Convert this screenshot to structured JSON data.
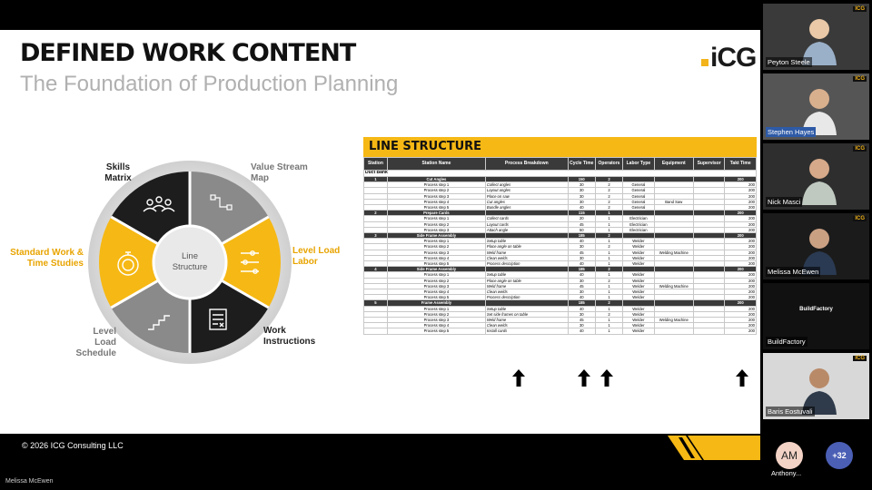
{
  "slide": {
    "title": "DEFINED WORK CONTENT",
    "subtitle": "The Foundation of Production Planning",
    "logo": "iCG",
    "footer": "© 2026 ICG Consulting LLC",
    "colors": {
      "accent": "#f6b814",
      "dark": "#1d1d1d",
      "grey": "#8a8a8a"
    }
  },
  "wheel": {
    "center": "Line Structure",
    "labels": {
      "skills": "Skills Matrix",
      "value": "Value Stream Map",
      "level_load_labor": "Level Load Labor",
      "work_instructions": "Work Instructions",
      "level_load_schedule": "Level Load Schedule",
      "standard_work": "Standard Work & Time Studies"
    }
  },
  "line_structure": {
    "title": "LINE STRUCTURE",
    "headers": [
      "Station",
      "Station Name",
      "Process Breakdown",
      "Cycle Time",
      "Operators",
      "Labor Type",
      "Equipment",
      "Supervisor",
      "Takt Time"
    ],
    "group": "Duct Bank",
    "stations": [
      {
        "num": "1",
        "name": "Cut Angles",
        "cycle": "150",
        "ops": "2",
        "takt": "200",
        "steps": [
          [
            "Process step 1",
            "Collect angles",
            "30",
            "2",
            "General",
            "",
            "200"
          ],
          [
            "Process step 2",
            "Layout angles",
            "30",
            "2",
            "General",
            "",
            "200"
          ],
          [
            "Process step 3",
            "Place on saw",
            "30",
            "2",
            "General",
            "",
            "200"
          ],
          [
            "Process step 4",
            "Cut angles",
            "30",
            "2",
            "General",
            "Band Saw",
            "200"
          ],
          [
            "Process step 5",
            "Bundle angles",
            "40",
            "2",
            "General",
            "",
            "200"
          ]
        ]
      },
      {
        "num": "2",
        "name": "Prepare Cards",
        "cycle": "115",
        "ops": "1",
        "takt": "200",
        "steps": [
          [
            "Process step 1",
            "Collect cards",
            "20",
            "1",
            "Electrician",
            "",
            "200"
          ],
          [
            "Process step 2",
            "Layout cards",
            "45",
            "1",
            "Electrician",
            "",
            "200"
          ],
          [
            "Process step 3",
            "Attach angle",
            "50",
            "1",
            "Electrician",
            "",
            "200"
          ]
        ]
      },
      {
        "num": "3",
        "name": "Side Frame Assembly",
        "cycle": "185",
        "ops": "2",
        "takt": "200",
        "steps": [
          [
            "Process step 1",
            "Setup table",
            "40",
            "1",
            "Welder",
            "",
            "200"
          ],
          [
            "Process step 2",
            "Place angle on table",
            "30",
            "2",
            "Welder",
            "",
            "200"
          ],
          [
            "Process step 3",
            "Weld frame",
            "45",
            "1",
            "Welder",
            "Welding Machine",
            "200"
          ],
          [
            "Process step 4",
            "Clean welds",
            "30",
            "1",
            "Welder",
            "",
            "200"
          ],
          [
            "Process step 5",
            "Process description",
            "40",
            "1",
            "Welder",
            "",
            "200"
          ]
        ]
      },
      {
        "num": "4",
        "name": "Side Frame Assembly",
        "cycle": "185",
        "ops": "2",
        "takt": "200",
        "steps": [
          [
            "Process step 1",
            "Setup table",
            "40",
            "1",
            "Welder",
            "",
            "200"
          ],
          [
            "Process step 2",
            "Place angle on table",
            "30",
            "2",
            "Welder",
            "",
            "200"
          ],
          [
            "Process step 3",
            "Weld frame",
            "45",
            "1",
            "Welder",
            "Welding Machine",
            "200"
          ],
          [
            "Process step 4",
            "Clean welds",
            "30",
            "1",
            "Welder",
            "",
            "200"
          ],
          [
            "Process step 5",
            "Process description",
            "40",
            "1",
            "Welder",
            "",
            "200"
          ]
        ]
      },
      {
        "num": "5",
        "name": "Frame Assembly",
        "cycle": "185",
        "ops": "2",
        "takt": "200",
        "steps": [
          [
            "Process step 1",
            "Setup table",
            "40",
            "1",
            "Welder",
            "",
            "200"
          ],
          [
            "Process step 2",
            "Set side frames on table",
            "30",
            "2",
            "Welder",
            "",
            "200"
          ],
          [
            "Process step 3",
            "Weld frame",
            "45",
            "1",
            "Welder",
            "Welding Machine",
            "200"
          ],
          [
            "Process step 4",
            "Clean welds",
            "30",
            "1",
            "Welder",
            "",
            "200"
          ],
          [
            "Process step 5",
            "Install cards",
            "40",
            "1",
            "Welder",
            "",
            "200"
          ]
        ]
      }
    ]
  },
  "participants": [
    {
      "name": "Peyton Steele"
    },
    {
      "name": "Stephen Hayes"
    },
    {
      "name": "Nick Masci"
    },
    {
      "name": "Melissa McEwen"
    },
    {
      "name": "BuildFactory",
      "caption": "BuildFactory"
    },
    {
      "name": "Baris Eostuvali"
    }
  ],
  "extra": {
    "initials": "AM",
    "name": "Anthony...",
    "more": "+32"
  },
  "presenter": "Melissa McEwen"
}
